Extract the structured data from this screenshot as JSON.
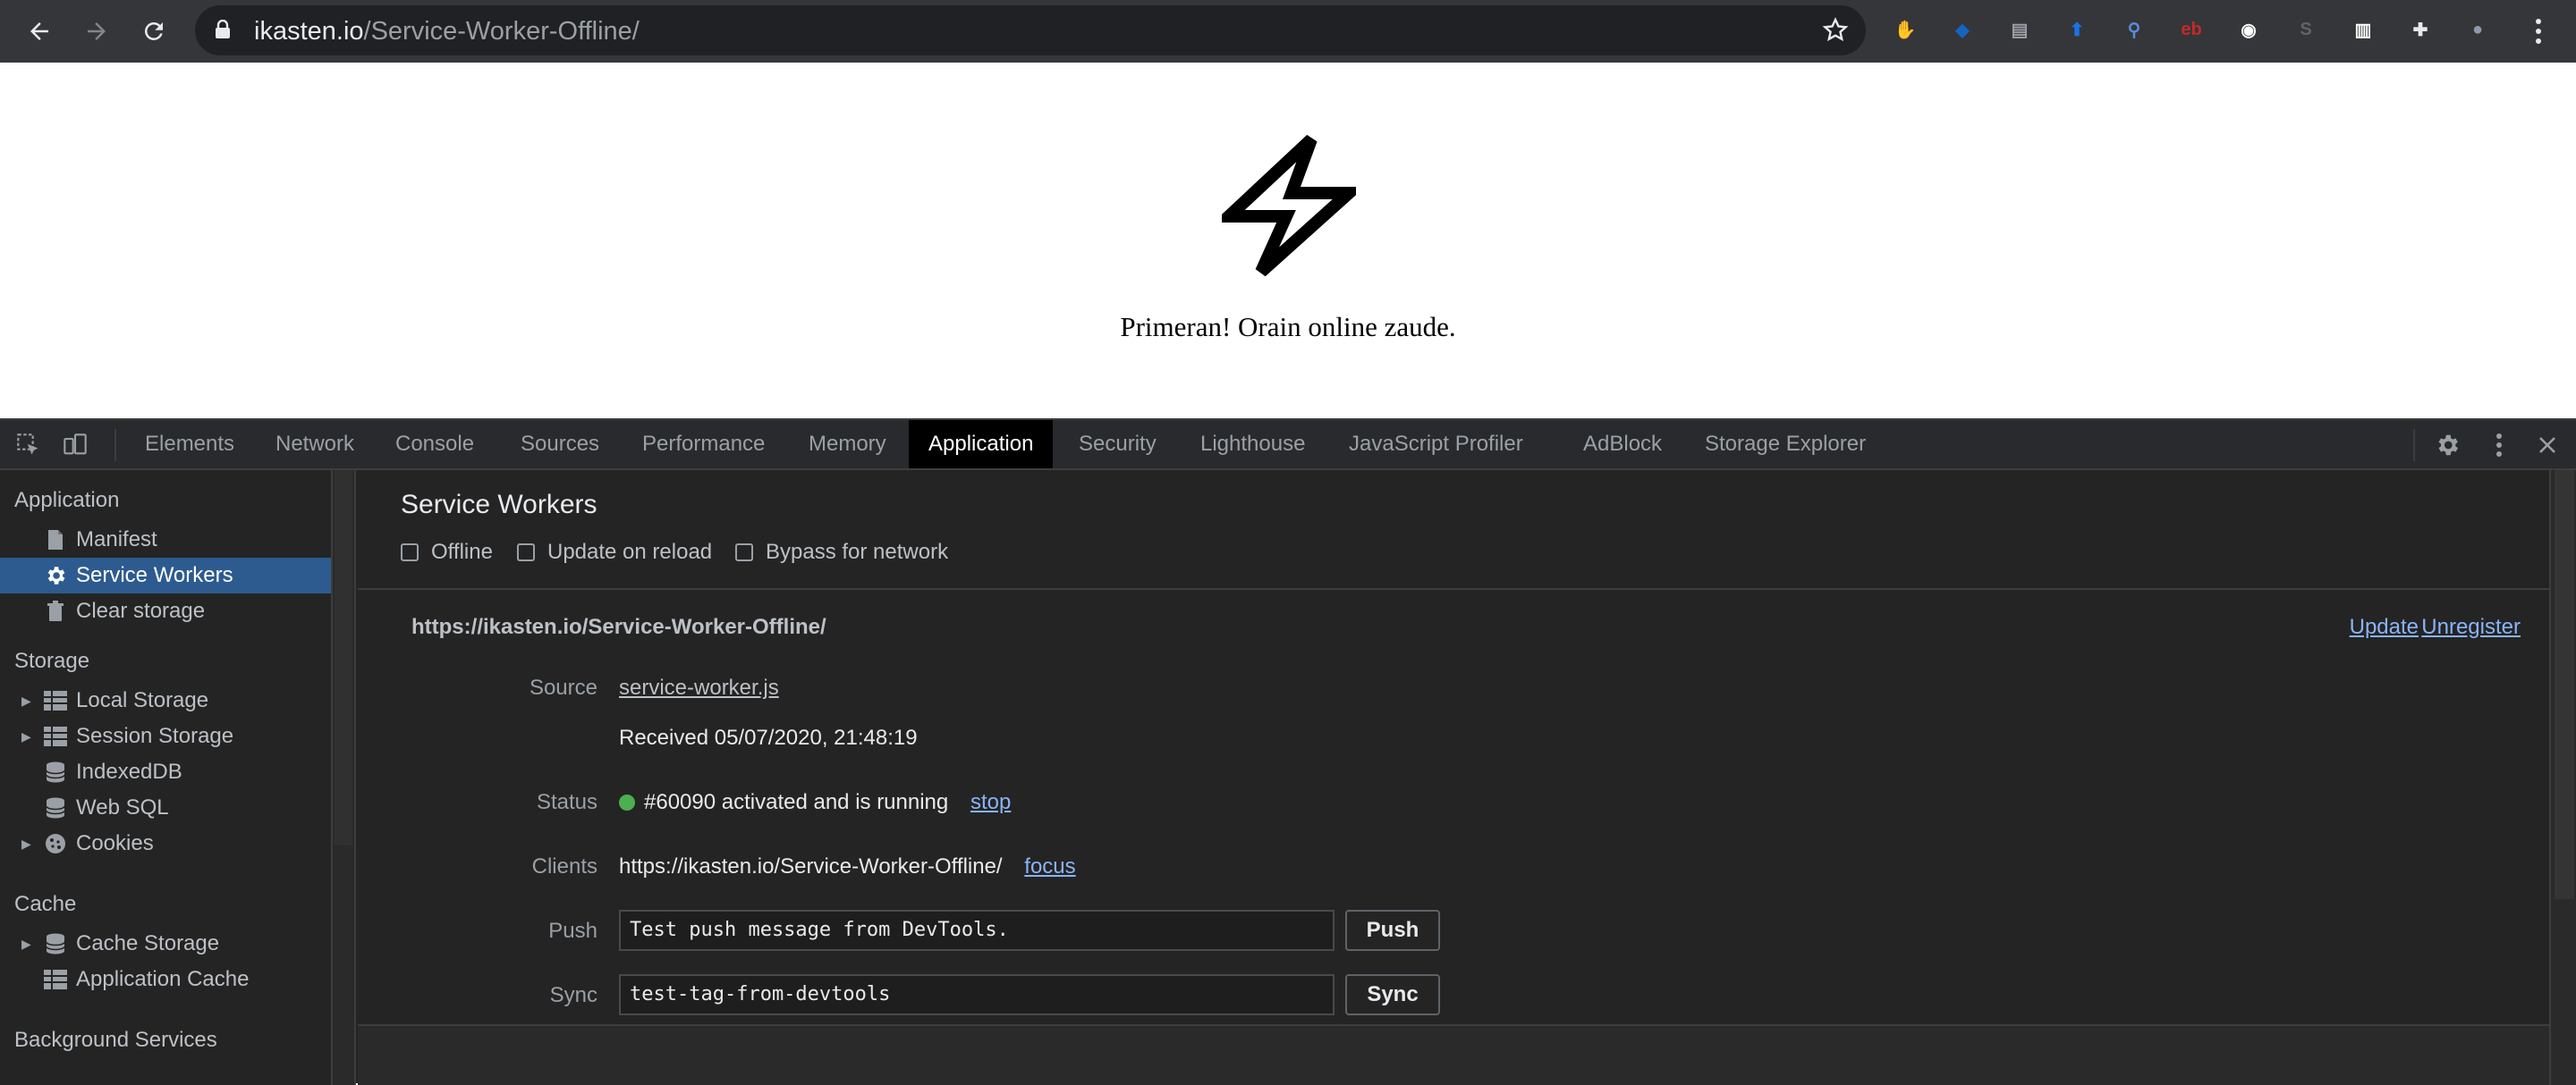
{
  "browser": {
    "url_host": "ikasten.io",
    "url_path": "/Service-Worker-Offline/",
    "extensions": [
      {
        "name": "adblock-icon",
        "color": "#e02424",
        "glyph": "✋"
      },
      {
        "name": "gem-icon",
        "color": "#1565c0",
        "glyph": "◆"
      },
      {
        "name": "doc-icon",
        "color": "#9aa0a6",
        "glyph": "▤"
      },
      {
        "name": "graduation-icon",
        "color": "#1a73e8",
        "glyph": "⬆"
      },
      {
        "name": "magnifier-ext-icon",
        "color": "#5b8bd8",
        "glyph": "⚲"
      },
      {
        "name": "eb-icon",
        "color": "#c62828",
        "glyph": "eb"
      },
      {
        "name": "face-ext-icon",
        "color": "#ffffff",
        "glyph": "◉"
      },
      {
        "name": "s-ext-icon",
        "color": "#5f6368",
        "glyph": "S"
      },
      {
        "name": "barcode-ext-icon",
        "color": "#ffffff",
        "glyph": "▥"
      },
      {
        "name": "puzzle-icon",
        "color": "#e8eaed",
        "glyph": "✚"
      },
      {
        "name": "profile-avatar",
        "color": "#8a9bb0",
        "glyph": "●"
      }
    ]
  },
  "page": {
    "message": "Primeran! Orain online zaude."
  },
  "devtools": {
    "tabs": [
      "Elements",
      "Network",
      "Console",
      "Sources",
      "Performance",
      "Memory",
      "Application",
      "Security",
      "Lighthouse",
      "JavaScript Profiler",
      "AdBlock",
      "Storage Explorer"
    ],
    "active_tab": "Application",
    "sidebar": {
      "application_header": "Application",
      "manifest": "Manifest",
      "service_workers": "Service Workers",
      "clear_storage": "Clear storage",
      "storage_header": "Storage",
      "local_storage": "Local Storage",
      "session_storage": "Session Storage",
      "indexeddb": "IndexedDB",
      "web_sql": "Web SQL",
      "cookies": "Cookies",
      "cache_header": "Cache",
      "cache_storage": "Cache Storage",
      "application_cache": "Application Cache",
      "background_header": "Background Services"
    },
    "main": {
      "title": "Service Workers",
      "opt_offline": "Offline",
      "opt_update_on_reload": "Update on reload",
      "opt_bypass": "Bypass for network",
      "scope": "https://ikasten.io/Service-Worker-Offline/",
      "update_link": "Update",
      "unregister_link": "Unregister",
      "source_label": "Source",
      "source_file": "service-worker.js",
      "received": "Received 05/07/2020, 21:48:19",
      "status_label": "Status",
      "status_text": "#60090 activated and is running",
      "stop_link": "stop",
      "clients_label": "Clients",
      "clients_url": "https://ikasten.io/Service-Worker-Offline/",
      "focus_link": "focus",
      "push_label": "Push",
      "push_value": "Test push message from DevTools.",
      "push_button": "Push",
      "sync_label": "Sync",
      "sync_value": "test-tag-from-devtools",
      "sync_button": "Sync"
    }
  }
}
